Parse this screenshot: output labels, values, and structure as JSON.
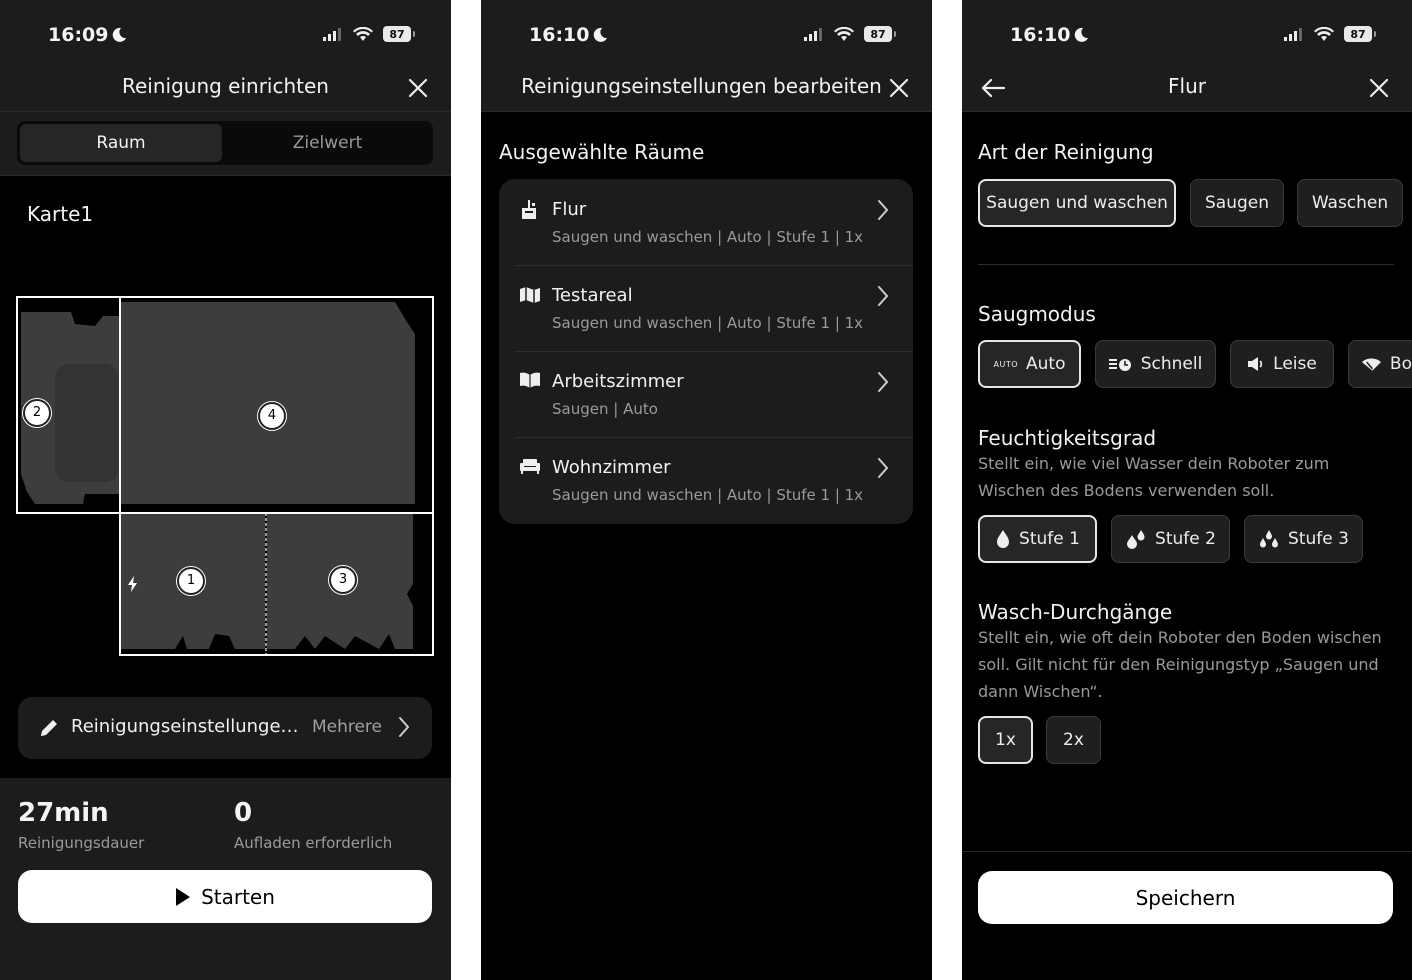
{
  "screen1": {
    "time": "16:09",
    "battery": "87",
    "title": "Reinigung einrichten",
    "segments": {
      "active": "Raum",
      "inactive": "Zielwert"
    },
    "map_title": "Karte1",
    "room_labels": [
      "2",
      "4",
      "1",
      "3"
    ],
    "settings_label": "Reinigungseinstellungen bearbeiten",
    "settings_value": "Mehrere",
    "stats": [
      {
        "value": "27min",
        "label": "Reinigungsdauer"
      },
      {
        "value": "0",
        "label": "Aufladen erforderlich"
      }
    ],
    "start_label": "Starten",
    "colors": {
      "map_room": "#3d3d3d",
      "outline": "#ffffff"
    }
  },
  "screen2": {
    "time": "16:10",
    "battery": "87",
    "title": "Reinigungseinstellungen bearbeiten",
    "section": "Ausgewählte Räume",
    "rooms": [
      {
        "name": "Flur",
        "sub": "Saugen und waschen | Auto | Stufe 1 | 1x",
        "icon": "hallway-icon"
      },
      {
        "name": "Testareal",
        "sub": "Saugen und waschen | Auto | Stufe 1 | 1x",
        "icon": "area-icon"
      },
      {
        "name": "Arbeitszimmer",
        "sub": "Saugen | Auto",
        "icon": "book-icon"
      },
      {
        "name": "Wohnzimmer",
        "sub": "Saugen und waschen | Auto | Stufe 1 | 1x",
        "icon": "sofa-icon"
      }
    ]
  },
  "screen3": {
    "time": "16:10",
    "battery": "87",
    "title": "Flur",
    "type_heading": "Art der Reinigung",
    "types": [
      "Saugen und waschen",
      "Saugen",
      "Waschen"
    ],
    "suction_heading": "Saugmodus",
    "suction_modes": [
      {
        "badge": "AUTO",
        "label": "Auto"
      },
      {
        "label": "Schnell"
      },
      {
        "label": "Leise"
      },
      {
        "label": "Bo"
      }
    ],
    "moisture_heading": "Feuchtigkeitsgrad",
    "moisture_desc": "Stellt ein, wie viel Wasser dein Roboter zum Wischen des Bodens verwenden soll.",
    "moisture_levels": [
      "Stufe 1",
      "Stufe 2",
      "Stufe 3"
    ],
    "passes_heading": "Wasch-Durchgänge",
    "passes_desc": "Stellt ein, wie oft dein Roboter den Boden wischen soll. Gilt nicht für den Reinigungstyp „Saugen und dann Wischen“.",
    "passes": [
      "1x",
      "2x"
    ],
    "save_label": "Speichern"
  }
}
